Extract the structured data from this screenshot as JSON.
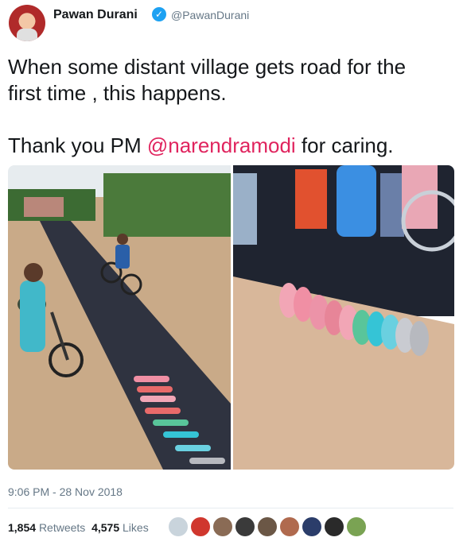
{
  "author": {
    "name": "Pawan Durani",
    "handle": "@PawanDurani",
    "verified_icon": "verified-badge-icon"
  },
  "tweet": {
    "line1": "When some distant village gets road for the",
    "line2": "first time , this happens.",
    "thanks_before": "Thank you PM ",
    "mention": "@narendramodi",
    "thanks_after": " for caring.",
    "mention_color": "#e0245e"
  },
  "timestamp": "9:06 PM - 28 Nov 2018",
  "stats": {
    "retweets_count": "1,854",
    "retweets_label": "Retweets",
    "likes_count": "4,575",
    "likes_label": "Likes"
  },
  "likers": [
    "#c9d4dc",
    "#d0372e",
    "#8a6b55",
    "#3a3a3a",
    "#6b5746",
    "#b06a4e",
    "#2b3d6a",
    "#2a2a2a",
    "#7aa353"
  ],
  "colors": {
    "accent": "#1da1f2",
    "muted": "#657786"
  }
}
